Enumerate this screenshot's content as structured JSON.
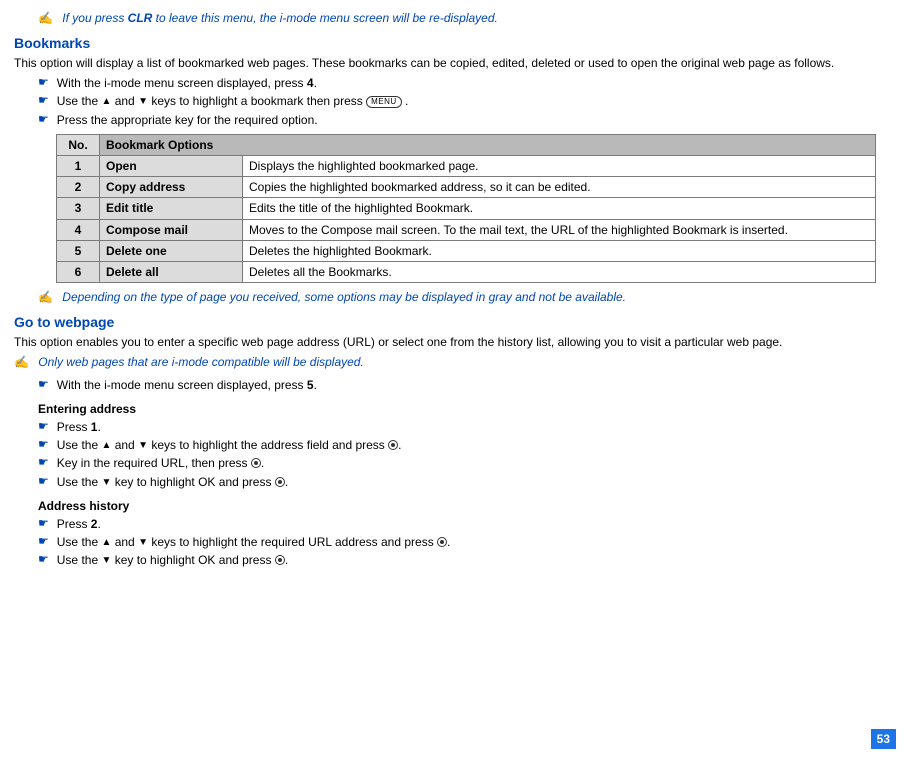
{
  "note_clr": {
    "pre": "If you press ",
    "clr": "CLR",
    "post": " to leave this menu, the i-mode menu screen will be re-displayed."
  },
  "bookmarks": {
    "heading": "Bookmarks",
    "intro": "This option will display a list of bookmarked web pages. These bookmarks can be copied, edited, deleted or used to open the original web page as follows.",
    "b1_pre": "With the i-mode menu screen displayed, press ",
    "b1_key": "4",
    "b1_post": ".",
    "b2_pre": "Use the ",
    "b2_mid": " and ",
    "b2_post1": " keys to highlight a bookmark then press ",
    "b2_menu": "MENU",
    "b2_post2": " .",
    "b3": "Press the appropriate key for the required option."
  },
  "table": {
    "head_no": "No.",
    "head_opt": "Bookmark Options",
    "rows": [
      {
        "no": "1",
        "name": "Open",
        "desc": "Displays the highlighted bookmarked page."
      },
      {
        "no": "2",
        "name": "Copy address",
        "desc": "Copies the highlighted bookmarked address, so it can be edited."
      },
      {
        "no": "3",
        "name": "Edit title",
        "desc": "Edits the title of the highlighted Bookmark."
      },
      {
        "no": "4",
        "name": "Compose mail",
        "desc": "Moves to the Compose mail screen. To the mail text, the URL of the highlighted Bookmark is inserted."
      },
      {
        "no": "5",
        "name": "Delete one",
        "desc": "Deletes the highlighted Bookmark."
      },
      {
        "no": "6",
        "name": "Delete all",
        "desc": "Deletes all the Bookmarks."
      }
    ]
  },
  "note_gray": "Depending on the type of page you received, some options may be displayed in gray and not be available.",
  "goto": {
    "heading": "Go to webpage",
    "intro": "This option enables you to enter a specific web page address (URL) or select one from the history list, allowing you to visit a particular web page.",
    "note": "Only web pages that are i-mode compatible will be displayed.",
    "b1_pre": "With the i-mode menu screen displayed, press ",
    "b1_key": "5",
    "b1_post": "."
  },
  "entering": {
    "heading": "Entering address",
    "b1_pre": "Press ",
    "b1_key": "1",
    "b1_post": ".",
    "b2_pre": "Use the ",
    "b2_mid": " and ",
    "b2_post": " keys to highlight the address field and press ",
    "b2_end": ".",
    "b3_pre": "Key in the required URL, then press ",
    "b3_end": ".",
    "b4_pre": "Use the ",
    "b4_post": " key to highlight OK and press ",
    "b4_end": "."
  },
  "history": {
    "heading": "Address history",
    "b1_pre": "Press ",
    "b1_key": "2",
    "b1_post": ".",
    "b2_pre": "Use the ",
    "b2_mid": " and ",
    "b2_post": " keys to highlight the required URL address and press ",
    "b2_end": ".",
    "b3_pre": "Use the ",
    "b3_post": " key to highlight OK and press ",
    "b3_end": "."
  },
  "page": "53"
}
